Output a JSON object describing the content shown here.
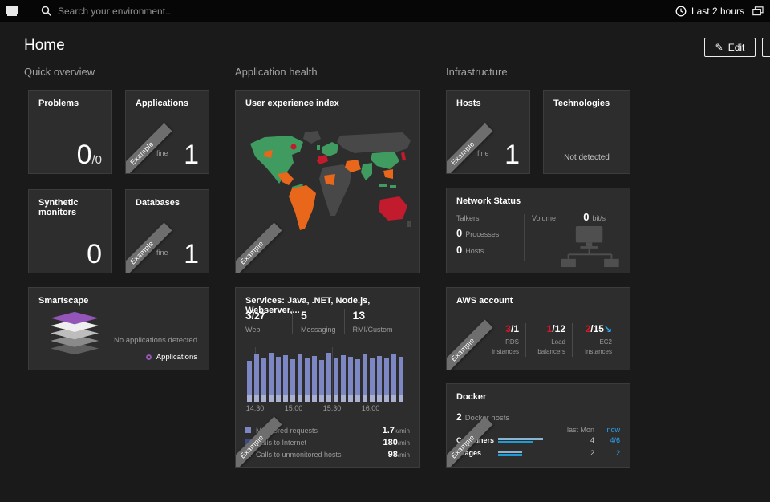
{
  "palette": {
    "accent_red": "#dc172a",
    "accent_blue": "#2aa5f2",
    "tile_bg": "#2d2d2d",
    "bar_blue": "#7d87c3"
  },
  "topbar": {
    "search_placeholder": "Search your environment...",
    "time_range": "Last 2 hours"
  },
  "page": {
    "title": "Home",
    "edit_button": "Edit",
    "more_button": "+"
  },
  "quick_overview": {
    "title": "Quick overview",
    "problems": {
      "title": "Problems",
      "value": "0",
      "denominator": "/0"
    },
    "applications": {
      "title": "Applications",
      "status": "fine",
      "value": "1",
      "ribbon": "Example"
    },
    "synthetic": {
      "title": "Synthetic monitors",
      "value": "0"
    },
    "databases": {
      "title": "Databases",
      "status": "fine",
      "value": "1",
      "ribbon": "Example"
    },
    "smartscape": {
      "title": "Smartscape",
      "message": "No applications detected",
      "legend_label": "Applications"
    }
  },
  "application_health": {
    "title": "Application health",
    "user_experience": {
      "title": "User experience index",
      "ribbon": "Example"
    },
    "services": {
      "title": "Services: Java, .NET, Node.js, Webserver,...",
      "stats": [
        {
          "num": "3",
          "den": "/27",
          "label": "Web"
        },
        {
          "num": "5",
          "den": "",
          "label": "Messaging"
        },
        {
          "num": "13",
          "den": "",
          "label": "RMI/Custom"
        }
      ],
      "x_ticks": [
        "14:30",
        "15:00",
        "15:30",
        "16:00"
      ],
      "legend": [
        {
          "label": "Monitored requests",
          "value": "1.7",
          "unit": "k/min",
          "color": "#7d87c3"
        },
        {
          "label": "Calls to Internet",
          "value": "180",
          "unit": "/min",
          "color": "#3f4d8c"
        },
        {
          "label": "Calls to unmonitored hosts",
          "value": "98",
          "unit": "/min",
          "color": "#8b8b8b"
        }
      ],
      "ribbon": "Example"
    }
  },
  "infrastructure": {
    "title": "Infrastructure",
    "hosts": {
      "title": "Hosts",
      "status": "fine",
      "value": "1",
      "ribbon": "Example"
    },
    "technologies": {
      "title": "Technologies",
      "message": "Not detected"
    },
    "network": {
      "title": "Network Status",
      "talkers_label": "Talkers",
      "processes_value": "0",
      "processes_label": "Processes",
      "hosts_value": "0",
      "hosts_label": "Hosts",
      "volume_label": "Volume",
      "volume_value": "0",
      "volume_unit": "bit/s"
    },
    "aws": {
      "title": "AWS account",
      "ribbon": "Example",
      "stats": [
        {
          "num": "3",
          "den": "/1",
          "line1": "RDS",
          "line2": "instances",
          "arrow": ""
        },
        {
          "num": "1",
          "den": "/12",
          "line1": "Load",
          "line2": "balancers",
          "arrow": ""
        },
        {
          "num": "2",
          "den": "/15",
          "line1": "EC2",
          "line2": "instances",
          "arrow": "↘"
        }
      ]
    },
    "docker": {
      "title": "Docker",
      "ribbon": "Example",
      "hosts_value": "2",
      "hosts_label": "Docker hosts",
      "col_last": "last Mon",
      "col_now": "now",
      "rows": [
        {
          "label": "Containers",
          "last": "4",
          "now": "4/6",
          "bar1": 56,
          "bar2": 44
        },
        {
          "label": "Images",
          "last": "2",
          "now": "2",
          "bar1": 30,
          "bar2": 30
        }
      ]
    }
  },
  "chart_data": {
    "type": "bar",
    "title": "Services: Java, .NET, Node.js, Webserver,...",
    "x_ticks": [
      "14:30",
      "15:00",
      "15:30",
      "16:00"
    ],
    "values": [
      50,
      58,
      54,
      60,
      55,
      57,
      52,
      59,
      54,
      56,
      51,
      60,
      53,
      57,
      55,
      52,
      58,
      54,
      56,
      53,
      59,
      55
    ],
    "base_height": 8,
    "legend_position": "bottom"
  }
}
